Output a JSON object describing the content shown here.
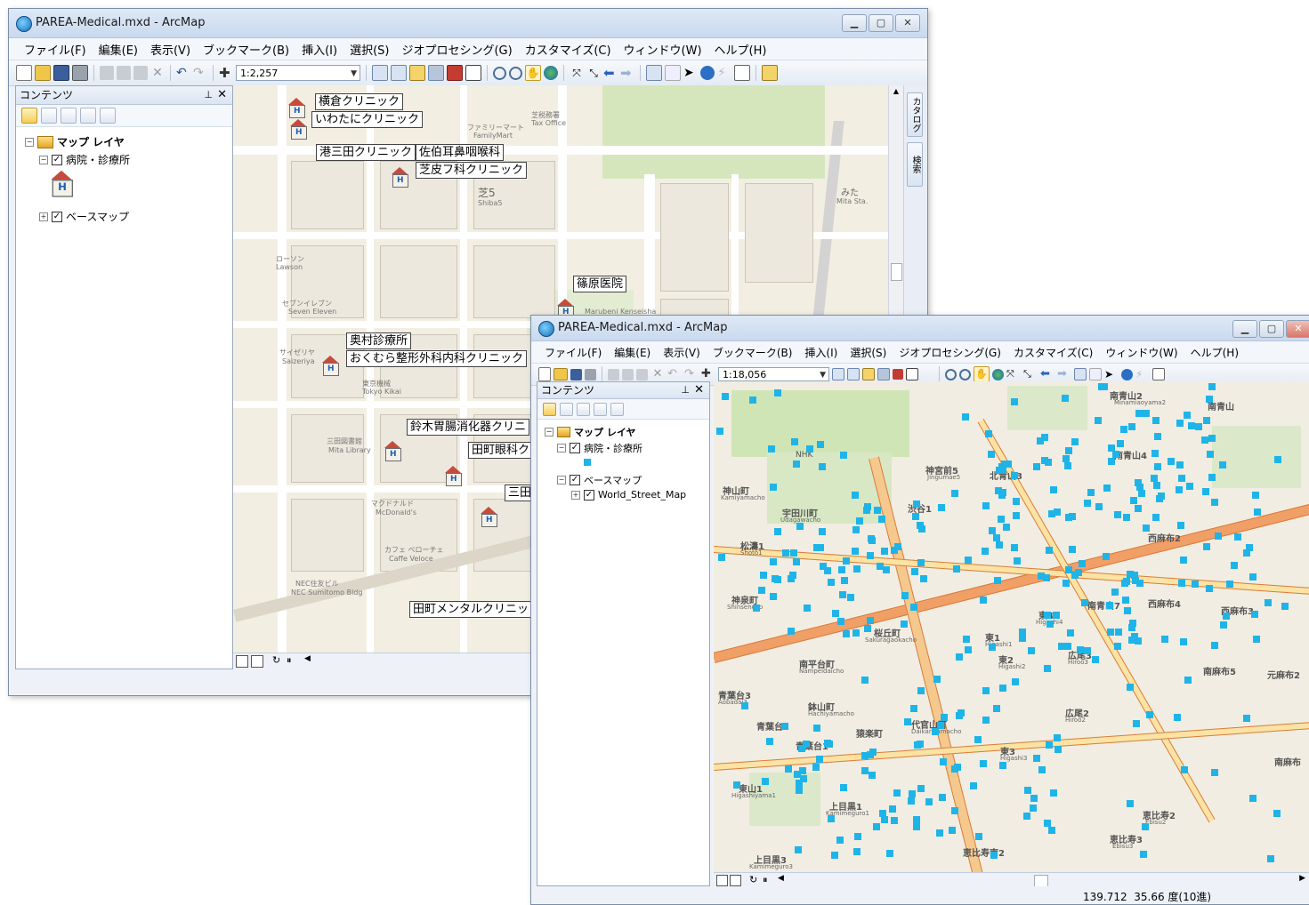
{
  "window1": {
    "title": "PAREA-Medical.mxd - ArcMap",
    "menus": [
      "ファイル(F)",
      "編集(E)",
      "表示(V)",
      "ブックマーク(B)",
      "挿入(I)",
      "選択(S)",
      "ジオプロセシング(G)",
      "カスタマイズ(C)",
      "ウィンドウ(W)",
      "ヘルプ(H)"
    ],
    "scale": "1:2,257",
    "toc": {
      "title": "コンテンツ",
      "root": "マップ レイヤ",
      "layer1": "病院・診療所",
      "layer2": "ベースマップ"
    },
    "dock_tabs": [
      "カタログ",
      "検索"
    ],
    "map_labels": [
      "横倉クリニック",
      "いわたにクリニック",
      "港三田クリニック",
      "佐伯耳鼻咽喉科",
      "芝皮フ科クリニック",
      "篠原医院",
      "奥村診療所",
      "おくむら整形外科内科クリニック",
      "鈴木胃腸消化器クリニ",
      "田町眼科ク",
      "三田",
      "田町メンタルクリニッ"
    ],
    "map_text": [
      "芝5",
      "Shiba5",
      "みた",
      "Mita Sta.",
      "芝税務署",
      "Tax Office",
      "ファミリーマート",
      "FamilyMart",
      "ローソン",
      "Lawson",
      "セブンイレブン",
      "Seven Eleven",
      "サイゼリヤ",
      "Saizeriya",
      "東京機械",
      "Tokyo Kikai",
      "三田図書館",
      "Mita Library",
      "マクドナルド",
      "McDonald's",
      "カフェ ベローチェ",
      "Caffe Veloce",
      "NEC住友ビル",
      "NEC Sumitomo Bldg",
      "篠原医院",
      "Marubeni Kenseisha"
    ]
  },
  "window2": {
    "title": "PAREA-Medical.mxd - ArcMap",
    "menus": [
      "ファイル(F)",
      "編集(E)",
      "表示(V)",
      "ブックマーク(B)",
      "挿入(I)",
      "選択(S)",
      "ジオプロセシング(G)",
      "カスタマイズ(C)",
      "ウィンドウ(W)",
      "ヘルプ(H)"
    ],
    "scale": "1:18,056",
    "toc": {
      "title": "コンテンツ",
      "root": "マップ レイヤ",
      "layer1": "病院・診療所",
      "layer2": "ベースマップ",
      "layer3": "World_Street_Map"
    },
    "map_text": [
      "南青山2",
      "Minamiaoyama2",
      "南青山",
      "神宮前5",
      "Jingumae5",
      "北青山3",
      "神山町",
      "Kamiyamacho",
      "宇田川町",
      "Udagawacho",
      "渋谷1",
      "松濤1",
      "Shoto1",
      "神泉町",
      "Shinsencho",
      "南青山4",
      "南青山7",
      "西麻布2",
      "西麻布4",
      "西麻布3",
      "東4",
      "Higashi4",
      "東1",
      "Higashi1",
      "東2",
      "Higashi2",
      "広尾3",
      "Hiroo3",
      "南麻布5",
      "南平台町",
      "Nampeidaicho",
      "鉢山町",
      "Hachiyamacho",
      "青葉台3",
      "Aobadai3",
      "青葉台2",
      "青葉台1",
      "猿楽町",
      "代官山町",
      "Daikanyamacho",
      "東3",
      "Higashi3",
      "広尾2",
      "Hiroo2",
      "東山1",
      "Higashiyama1",
      "上目黒1",
      "Kamimeguro1",
      "恵比寿南2",
      "恵比寿2",
      "Ebisu2",
      "恵比寿3",
      "Ebisu3",
      "上目黒3",
      "Kamimeguro3",
      "元麻布2",
      "NHK",
      "南麻布",
      "桜丘町",
      "Sakuragaokacho"
    ],
    "coords": "139.712  35.66 度(10進)"
  }
}
